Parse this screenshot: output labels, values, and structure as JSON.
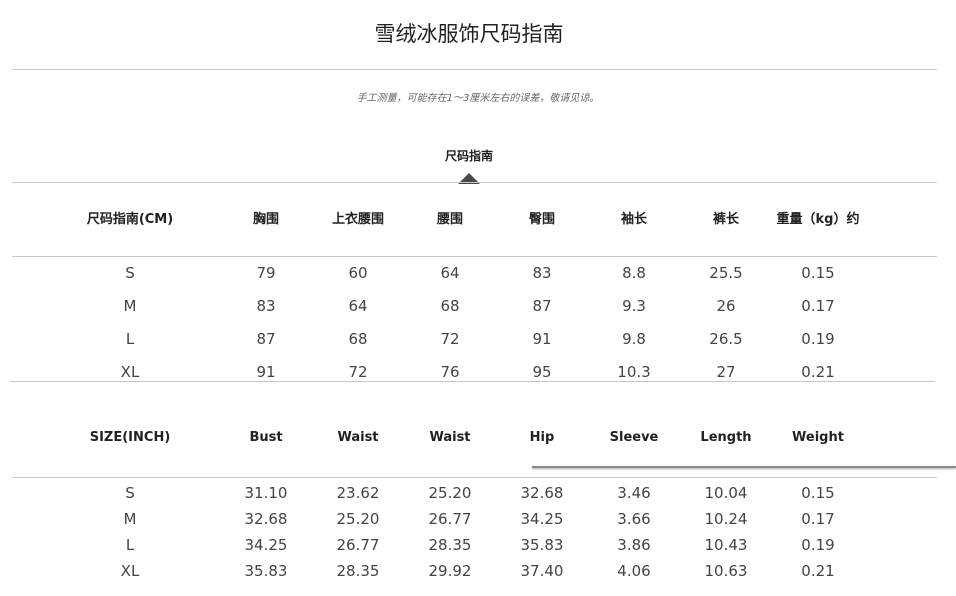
{
  "title": "雪绒冰服饰尺码指南",
  "note": "手工测量，可能存在1～3厘米左右的误差，敬请见谅。",
  "subtitle": "尺码指南",
  "cm_table": {
    "headers": [
      "尺码指南(CM)",
      "胸围",
      "上衣腰围",
      "腰围",
      "臀围",
      "袖长",
      "裤长",
      "重量（kg）约"
    ],
    "rows": [
      [
        "S",
        "79",
        "60",
        "64",
        "83",
        "8.8",
        "25.5",
        "0.15"
      ],
      [
        "M",
        "83",
        "64",
        "68",
        "87",
        "9.3",
        "26",
        "0.17"
      ],
      [
        "L",
        "87",
        "68",
        "72",
        "91",
        "9.8",
        "26.5",
        "0.19"
      ],
      [
        "XL",
        "91",
        "72",
        "76",
        "95",
        "10.3",
        "27",
        "0.21"
      ]
    ]
  },
  "inch_table": {
    "headers": [
      "SIZE(INCH)",
      "Bust",
      "Waist",
      "Waist",
      "Hip",
      "Sleeve",
      "Length",
      "Weight"
    ],
    "rows": [
      [
        "S",
        "31.10",
        "23.62",
        "25.20",
        "32.68",
        "3.46",
        "10.04",
        "0.15"
      ],
      [
        "M",
        "32.68",
        "25.20",
        "26.77",
        "34.25",
        "3.66",
        "10.24",
        "0.17"
      ],
      [
        "L",
        "34.25",
        "26.77",
        "28.35",
        "35.83",
        "3.86",
        "10.43",
        "0.19"
      ],
      [
        "XL",
        "35.83",
        "28.35",
        "29.92",
        "37.40",
        "4.06",
        "10.63",
        "0.21"
      ]
    ]
  }
}
